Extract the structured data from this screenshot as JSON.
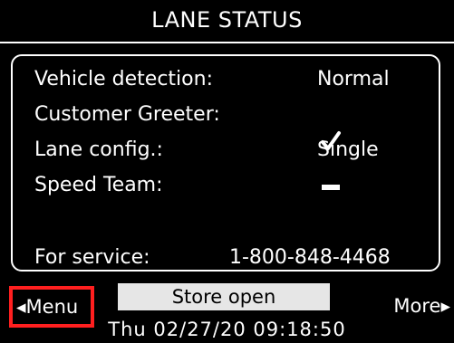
{
  "title": "LANE STATUS",
  "rows": [
    {
      "label": "Vehicle detection:",
      "value": "Normal"
    },
    {
      "label": "Customer Greeter:",
      "icon": "check-icon"
    },
    {
      "label": "Lane config.:",
      "value": "Single"
    },
    {
      "label": "Speed Team:",
      "icon": "dash-icon"
    }
  ],
  "service": {
    "label": "For service:",
    "phone": "1-800-848-4468"
  },
  "status": "Store open",
  "buttons": {
    "menu": "Menu",
    "more": "More"
  },
  "datetime": "Thu 02/27/20  09:18:50",
  "colors": {
    "background": "#000000",
    "foreground": "#ffffff",
    "highlight": "#ff1f1f",
    "status_bg": "#e6e6e6"
  }
}
